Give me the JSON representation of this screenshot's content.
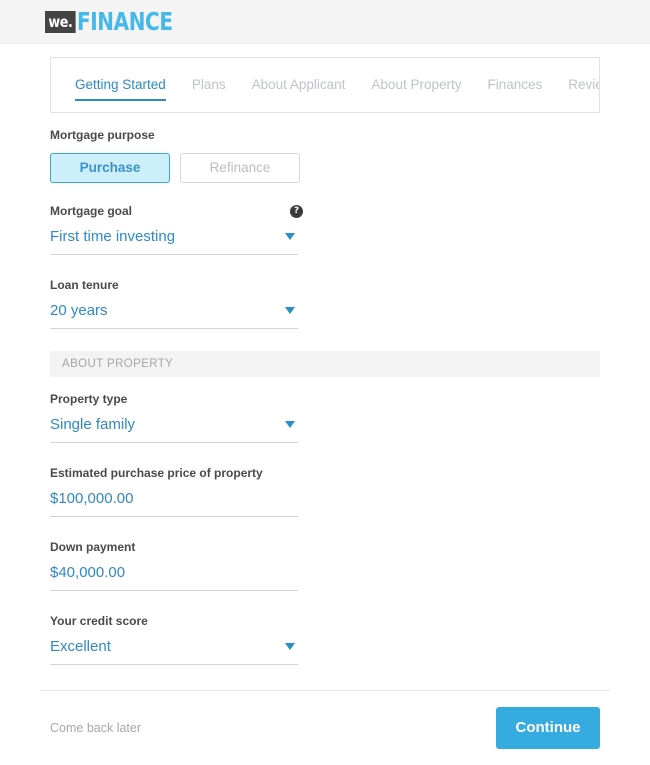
{
  "brand": {
    "mark": "we.",
    "word": "FINANCE",
    "mark_color": "#444444",
    "word_color": "#44b8e8"
  },
  "tabs": [
    {
      "label": "Getting Started",
      "active": true
    },
    {
      "label": "Plans",
      "active": false
    },
    {
      "label": "About Applicant",
      "active": false
    },
    {
      "label": "About Property",
      "active": false
    },
    {
      "label": "Finances",
      "active": false
    },
    {
      "label": "Review & Sign",
      "active": false
    }
  ],
  "form": {
    "mortgage_purpose": {
      "label": "Mortgage purpose",
      "options": [
        "Purchase",
        "Refinance"
      ],
      "selected": "Purchase",
      "purchase_label": "Purchase",
      "refinance_label": "Refinance"
    },
    "mortgage_goal": {
      "label": "Mortgage goal",
      "value": "First time investing",
      "help": "?"
    },
    "loan_tenure": {
      "label": "Loan tenure",
      "value": "20 years"
    },
    "section_about_property": "About Property",
    "property_type": {
      "label": "Property type",
      "value": "Single family"
    },
    "purchase_price": {
      "label": "Estimated purchase price of property",
      "value": "$100,000.00"
    },
    "down_payment": {
      "label": "Down payment",
      "value": "$40,000.00"
    },
    "credit_score": {
      "label": "Your credit score",
      "value": "Excellent"
    }
  },
  "footer": {
    "later_label": "Come back later",
    "continue_label": "Continue",
    "accent_color": "#35abe0"
  }
}
